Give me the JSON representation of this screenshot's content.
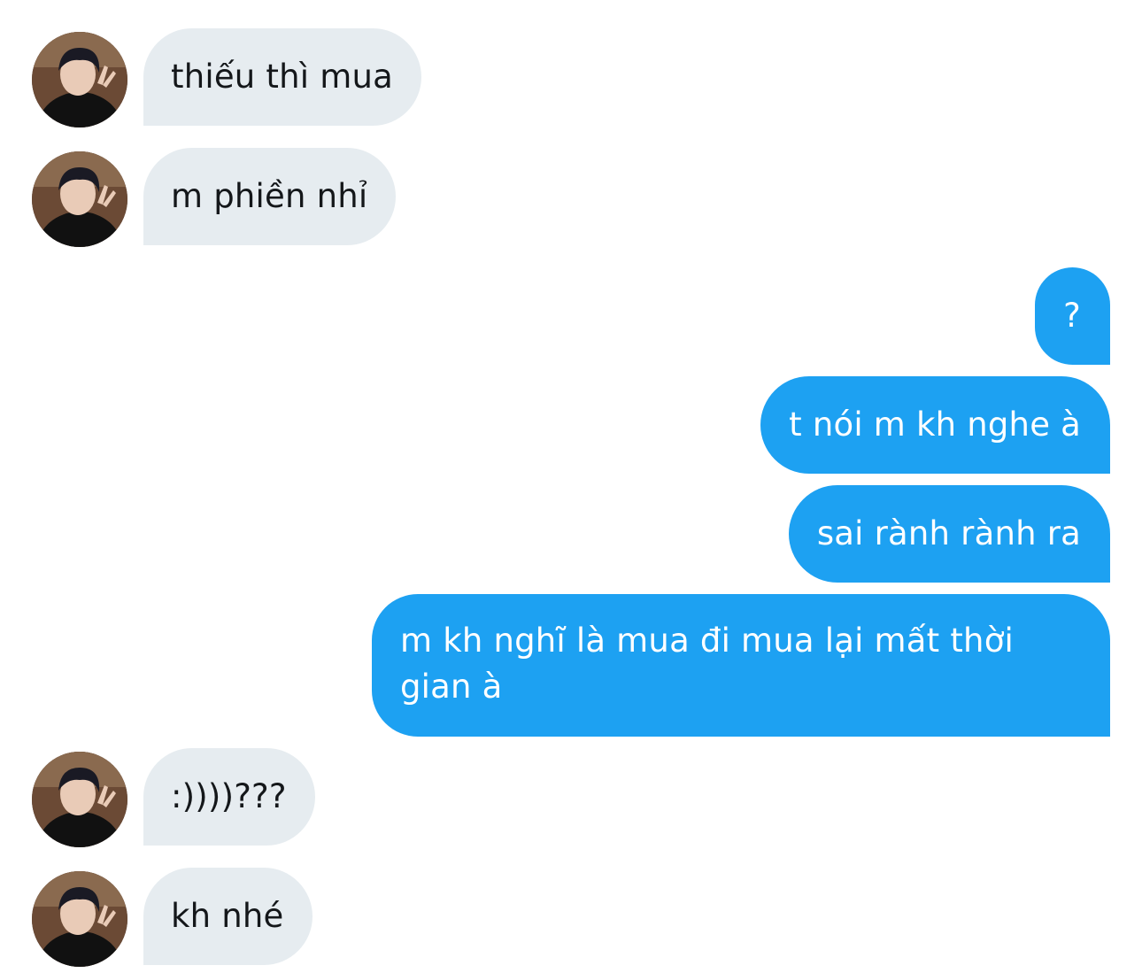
{
  "conversation": {
    "messages": [
      {
        "id": "m1",
        "direction": "incoming",
        "text": "thiếu thì mua"
      },
      {
        "id": "m2",
        "direction": "incoming",
        "text": "m phiền nhỉ"
      },
      {
        "id": "m3",
        "direction": "outgoing",
        "text": "?"
      },
      {
        "id": "m4",
        "direction": "outgoing",
        "text": "t nói m kh nghe à"
      },
      {
        "id": "m5",
        "direction": "outgoing",
        "text": "sai rành rành ra"
      },
      {
        "id": "m6",
        "direction": "outgoing",
        "text": "m kh nghĩ là mua đi mua lại mất thời gian à"
      },
      {
        "id": "m7",
        "direction": "incoming",
        "text": ":))))???"
      },
      {
        "id": "m8",
        "direction": "incoming",
        "text": "kh nhé"
      }
    ]
  },
  "colors": {
    "incoming_bubble": "#e6ecf0",
    "incoming_text": "#14171a",
    "outgoing_bubble": "#1da1f2",
    "outgoing_text": "#ffffff",
    "background": "#ffffff"
  },
  "icons": {
    "avatar": "user-avatar-photo"
  }
}
